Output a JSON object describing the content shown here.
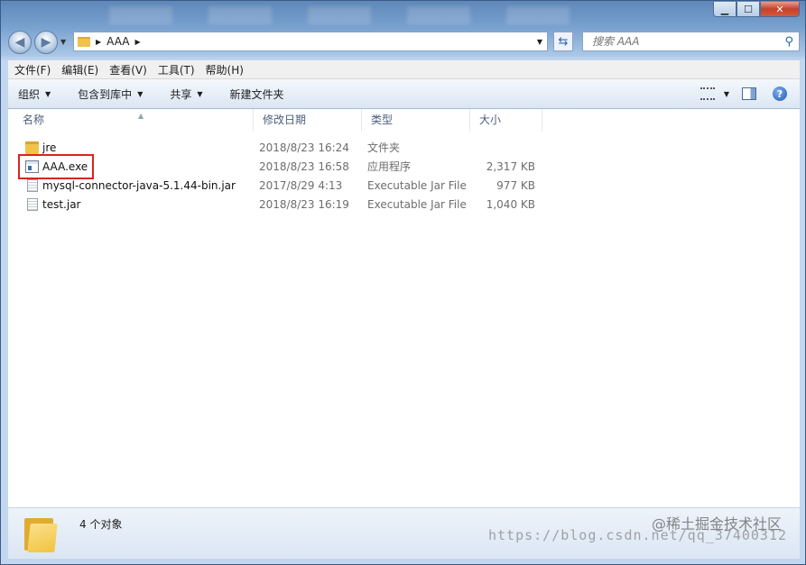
{
  "address": {
    "path": [
      "AAA"
    ],
    "search_placeholder": "搜索 AAA"
  },
  "menu": [
    "文件(F)",
    "编辑(E)",
    "查看(V)",
    "工具(T)",
    "帮助(H)"
  ],
  "toolbar": {
    "organize": "组织",
    "include_library": "包含到库中",
    "share": "共享",
    "new_folder": "新建文件夹",
    "help": "?"
  },
  "columns": {
    "name": "名称",
    "date": "修改日期",
    "type": "类型",
    "size": "大小"
  },
  "files": [
    {
      "name": "jre",
      "date": "2018/8/23 16:24",
      "type": "文件夹",
      "size": "",
      "icon": "folder-icon"
    },
    {
      "name": "AAA.exe",
      "date": "2018/8/23 16:58",
      "type": "应用程序",
      "size": "2,317 KB",
      "icon": "exe-icon"
    },
    {
      "name": "mysql-connector-java-5.1.44-bin.jar",
      "date": "2017/8/29 4:13",
      "type": "Executable Jar File",
      "size": "977 KB",
      "icon": "jar-icon"
    },
    {
      "name": "test.jar",
      "date": "2018/8/23 16:19",
      "type": "Executable Jar File",
      "size": "1,040 KB",
      "icon": "jar-icon"
    }
  ],
  "status": {
    "count": "4 个对象"
  },
  "watermark": {
    "site": "@稀土掘金技术社区",
    "url": "https://blog.csdn.net/qq_37400312"
  },
  "colors": {
    "highlight": "#d6261f",
    "frame": "#7aa2d0",
    "commandbar": "#dbe6f3"
  }
}
